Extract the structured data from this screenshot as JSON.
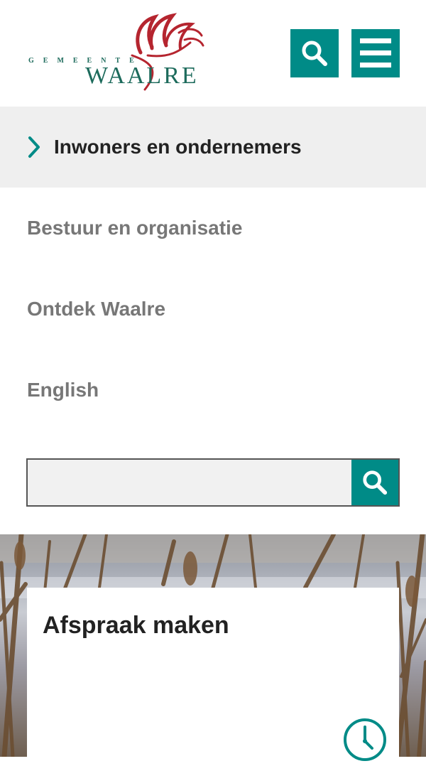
{
  "header": {
    "logo": {
      "line1": "GEMEENTE",
      "line2": "WAALRE"
    },
    "search_icon": "search-icon",
    "menu_icon": "hamburger-menu-icon"
  },
  "nav": {
    "items": [
      {
        "label": "Inwoners en ondernemers",
        "active": true
      },
      {
        "label": "Bestuur en organisatie",
        "active": false
      },
      {
        "label": "Ontdek Waalre",
        "active": false
      },
      {
        "label": "English",
        "active": false
      }
    ]
  },
  "search": {
    "value": "",
    "placeholder": "",
    "button_icon": "search-icon"
  },
  "card": {
    "title": "Afspraak maken",
    "icon": "clock-icon"
  },
  "colors": {
    "accent": "#008b87",
    "logo_red": "#b5252f",
    "logo_text": "#1d6b5c",
    "active_bg": "#efefef"
  }
}
